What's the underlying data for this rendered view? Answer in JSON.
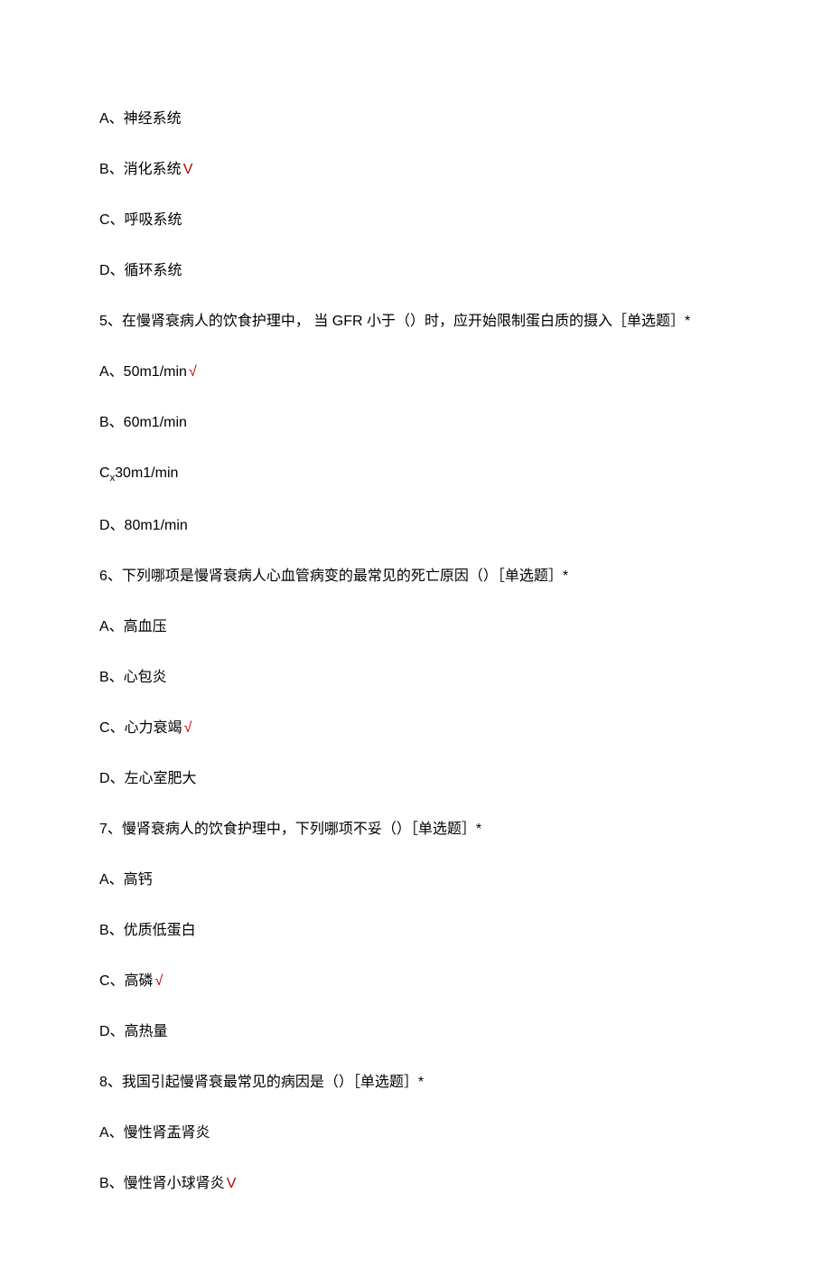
{
  "q4_options": {
    "a": "A、神经系统",
    "b": "B、消化系统",
    "b_mark": "V",
    "c": "C、呼吸系统",
    "d": "D、循环系统"
  },
  "q5": {
    "stem": "5、在慢肾衰病人的饮食护理中， 当 GFR 小于（）时，应开始限制蛋白质的摄入［单选题］*",
    "a": "A、50m1/min",
    "a_mark": "√",
    "b": "B、60m1/min",
    "c_prefix": "C",
    "c_sub": "x",
    "c_text": "30m1/min",
    "d": "D、80m1/min"
  },
  "q6": {
    "stem": "6、下列哪项是慢肾衰病人心血管病变的最常见的死亡原因（）［单选题］*",
    "a": "A、高血压",
    "b": "B、心包炎",
    "c": "C、心力衰竭",
    "c_mark": "√",
    "d": "D、左心室肥大"
  },
  "q7": {
    "stem": "7、慢肾衰病人的饮食护理中，下列哪项不妥（）［单选题］*",
    "a": "A、高钙",
    "b": "B、优质低蛋白",
    "c": "C、高磷",
    "c_mark": "√",
    "d": "D、高热量"
  },
  "q8": {
    "stem": "8、我国引起慢肾衰最常见的病因是（）［单选题］*",
    "a": "A、慢性肾盂肾炎",
    "b": "B、慢性肾小球肾炎",
    "b_mark": "V"
  }
}
